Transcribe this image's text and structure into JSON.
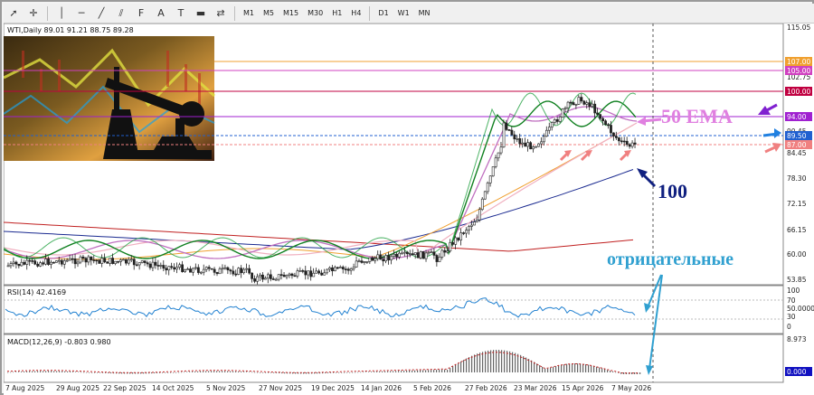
{
  "toolbar": {
    "icons": [
      "cursor-icon",
      "crosshair-icon",
      "vertical-line-icon",
      "horizontal-line-icon",
      "trendline-icon",
      "equidistant-channel-icon",
      "fibonacci-icon",
      "text-icon",
      "label-icon",
      "shapes-icon",
      "arrows-icon"
    ],
    "timeframes": [
      "M1",
      "M5",
      "M15",
      "M30",
      "H1",
      "H4",
      "D1",
      "W1",
      "MN"
    ]
  },
  "chart": {
    "header": "WTI,Daily  89.01 91.21 88.75 89.28",
    "price_axis": [
      "115.05",
      "102.75",
      "90.45",
      "84.45",
      "78.30",
      "72.15",
      "66.15",
      "60.00",
      "53.85"
    ],
    "price_tags": [
      {
        "label": "107.00",
        "color": "#f0a030"
      },
      {
        "label": "105.00",
        "color": "#d040c0"
      },
      {
        "label": "100.00",
        "color": "#c00040"
      },
      {
        "label": "94.00",
        "color": "#a020d0"
      },
      {
        "label": "89.50",
        "color": "#2060d0"
      },
      {
        "label": "87.00",
        "color": "#f08080"
      }
    ],
    "dates": [
      "7 Aug 2025",
      "29 Aug 2025",
      "22 Sep 2025",
      "14 Oct 2025",
      "5 Nov 2025",
      "27 Nov 2025",
      "19 Dec 2025",
      "14 Jan 2026",
      "5 Feb 2026",
      "27 Feb 2026",
      "23 Mar 2026",
      "15 Apr 2026",
      "7 May 2026"
    ],
    "annotations": {
      "ema50": "50 EMA",
      "ma100": "100",
      "negative": "отрицательные"
    }
  },
  "rsi": {
    "header": "RSI(14) 42.4169",
    "axis": [
      "100",
      "70",
      "50.0000",
      "30",
      "0"
    ],
    "value": 42.4169
  },
  "macd": {
    "header": "MACD(12,26,9) -0.803 0.980",
    "axis": [
      "8.973",
      "0.000"
    ],
    "macd": -0.803,
    "signal": 0.98
  },
  "colors": {
    "bull": "#1a1a1a",
    "ema50": "#c070c0",
    "ma100": "#1a2a90",
    "ma200": "#c02020",
    "ema_fast": "#20a040",
    "ema_mid": "#108020",
    "orange": "#f0a030",
    "pink": "#f0b0c0"
  }
}
